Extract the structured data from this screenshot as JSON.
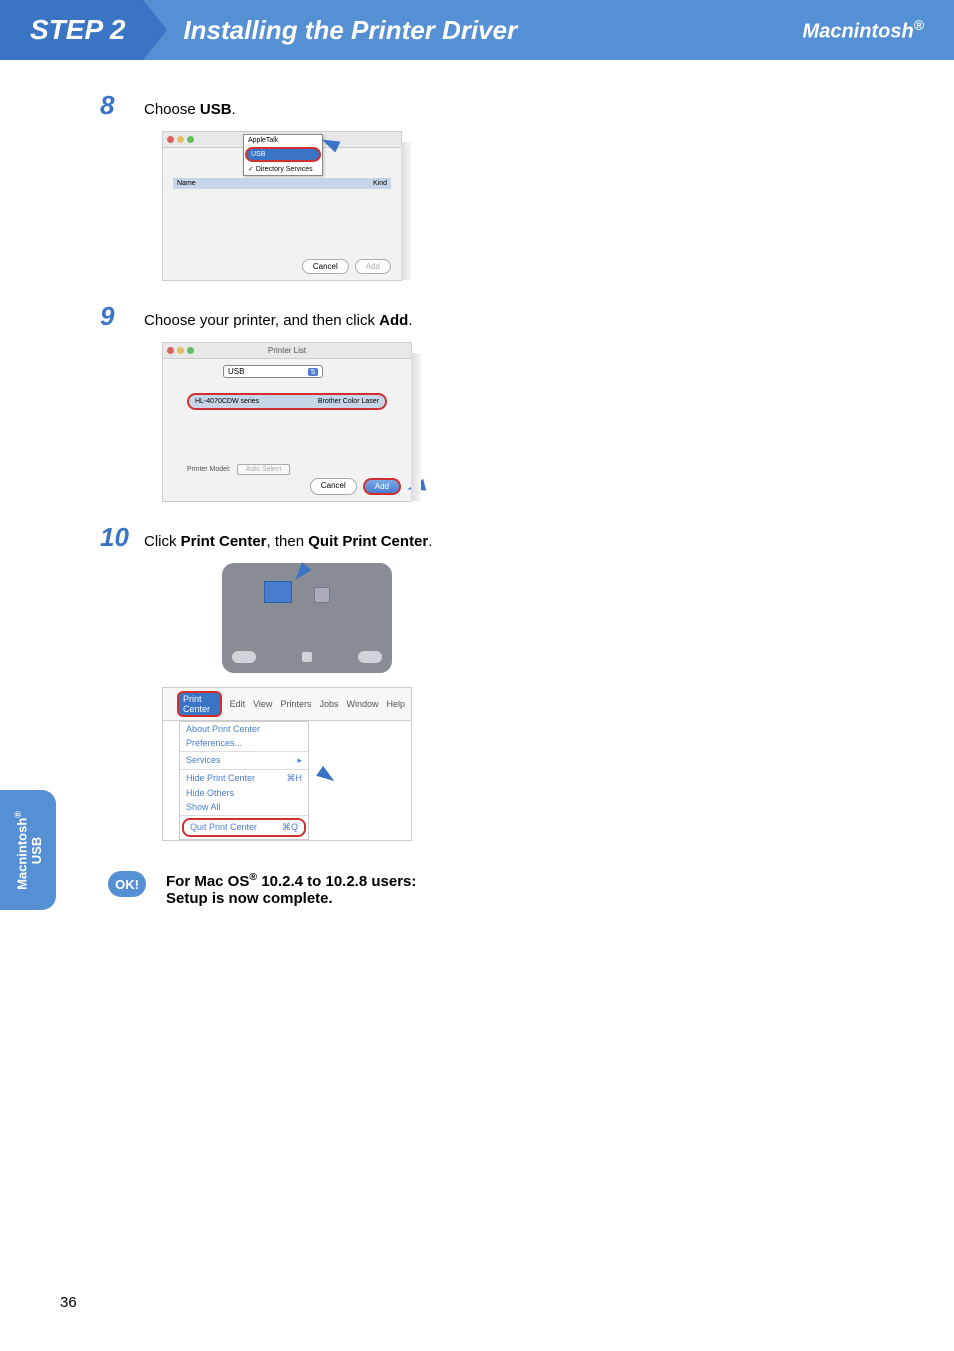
{
  "header": {
    "step_label": "STEP 2",
    "title": "Installing the Printer Driver",
    "platform": "Macnintosh",
    "platform_sup": "®"
  },
  "steps": {
    "s8": {
      "num": "8",
      "text_before": "Choose ",
      "bold": "USB",
      "text_after": "."
    },
    "s9": {
      "num": "9",
      "text_before": "Choose your printer, and then click ",
      "bold": "Add",
      "text_after": "."
    },
    "s10": {
      "num": "10",
      "text_before": "Click ",
      "bold1": "Print Center",
      "mid": ", then ",
      "bold2": "Quit Print Center",
      "text_after": "."
    }
  },
  "shot8": {
    "dd_item1": "AppleTalk",
    "dd_sel": "USB",
    "dd_item3": "Directory Services",
    "col1": "Name",
    "col2": "Kind",
    "btn_cancel": "Cancel",
    "btn_add": "Add"
  },
  "shot9": {
    "title": "Printer List",
    "select": "USB",
    "row_name": "HL-4070CDW series",
    "row_kind": "Brother Color Laser",
    "pm_label": "Printer Model:",
    "pm_value": "Auto Select",
    "btn_cancel": "Cancel",
    "btn_add": "Add"
  },
  "shot10b": {
    "menu_sel": "Print Center",
    "m_edit": "Edit",
    "m_view": "View",
    "m_printers": "Printers",
    "m_jobs": "Jobs",
    "m_window": "Window",
    "m_help": "Help",
    "dd_about": "About Print Center",
    "dd_prefs": "Preferences...",
    "dd_services": "Services",
    "dd_hide": "Hide Print Center",
    "dd_hide_sc": "⌘H",
    "dd_hideothers": "Hide Others",
    "dd_showall": "Show All",
    "dd_quit": "Quit Print Center",
    "dd_quit_sc": "⌘Q"
  },
  "ok": {
    "badge": "OK!",
    "line1a": "For Mac OS",
    "line1_sup": "®",
    "line1b": " 10.2.4 to 10.2.8 users:",
    "line2": "Setup is now complete."
  },
  "side_tab": {
    "line1": "Macnintosh",
    "sup": "®",
    "line2": "USB"
  },
  "page_number": "36"
}
